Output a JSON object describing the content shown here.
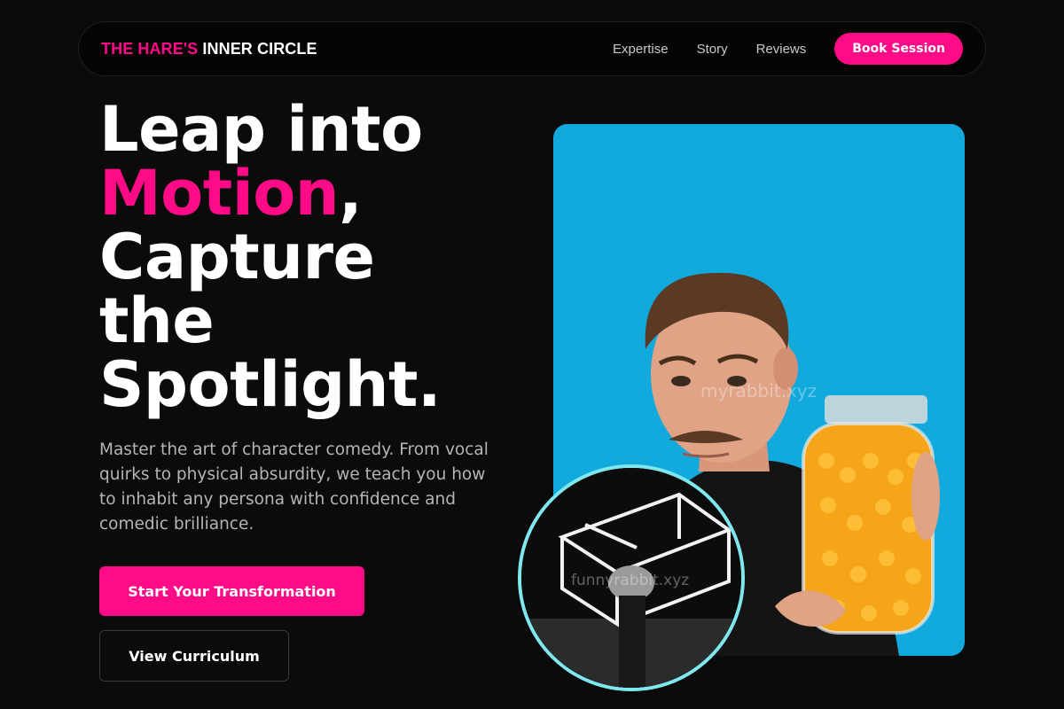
{
  "nav": {
    "brand_accent": "THE HARE'S",
    "brand_rest": "INNER CIRCLE",
    "links": [
      {
        "label": "Expertise"
      },
      {
        "label": "Story"
      },
      {
        "label": "Reviews"
      }
    ],
    "cta_label": "Book Session"
  },
  "hero": {
    "headline_line1": "Leap into",
    "headline_highlight": "Motion",
    "headline_comma": ",",
    "headline_line3": "Capture",
    "headline_line4": "the",
    "headline_line5": "Spotlight.",
    "lead": "Master the art of character comedy. From vocal quirks to physical absurdity, we teach you how to inhabit any persona with confidence and comedic brilliance.",
    "primary_cta": "Start Your Transformation",
    "secondary_cta": "View Curriculum"
  },
  "images": {
    "main_watermark": "myrabbit.xyz",
    "circle_watermark": "funnyrabbit.xyz"
  },
  "colors": {
    "accent": "#ff0a87",
    "background": "#0b0b0b",
    "photo_bg": "#12a9dd",
    "circle_border": "#7ee8ee"
  }
}
